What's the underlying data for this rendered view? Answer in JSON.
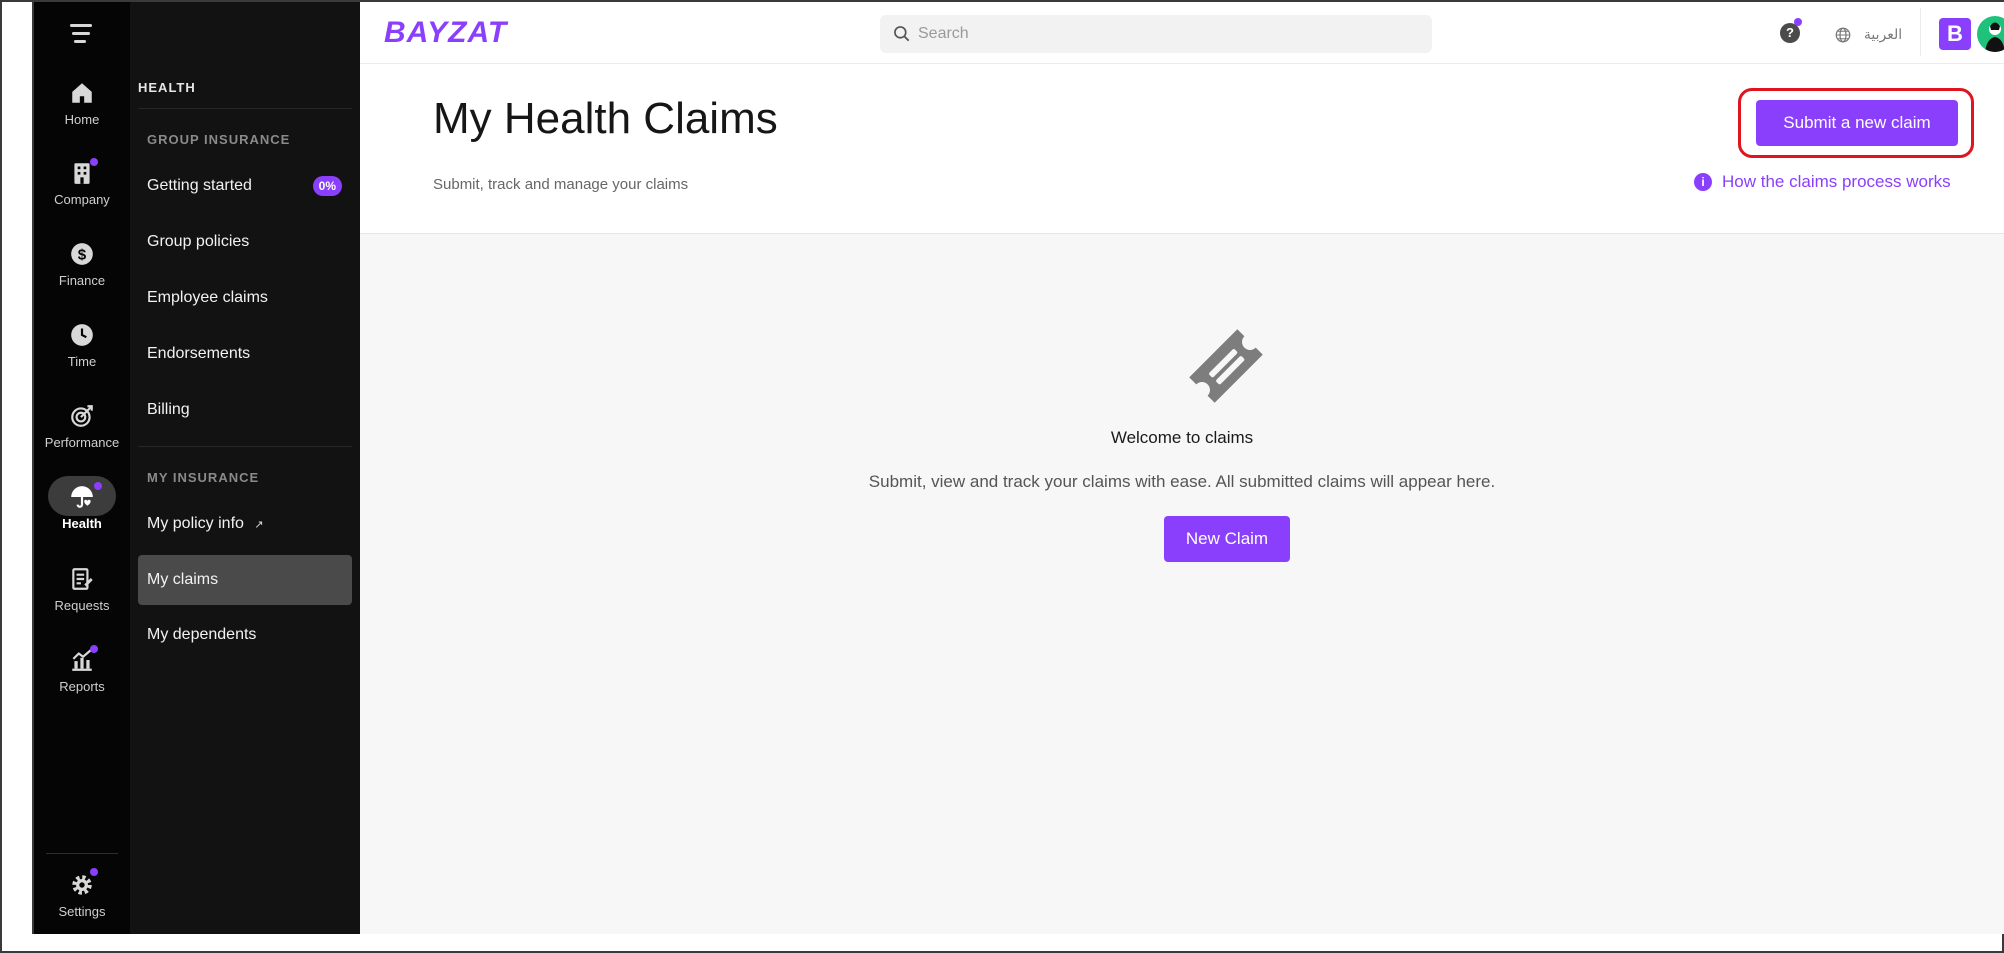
{
  "brand": {
    "logo_text": "BAYZAT",
    "accent_color": "#8a3ffc",
    "account_logo_letter": "B"
  },
  "rail": {
    "items": [
      {
        "label": "Home",
        "icon": "home-icon"
      },
      {
        "label": "Company",
        "icon": "building-icon"
      },
      {
        "label": "Finance",
        "icon": "dollar-icon"
      },
      {
        "label": "Time",
        "icon": "clock-icon"
      },
      {
        "label": "Performance",
        "icon": "target-icon"
      },
      {
        "label": "Health",
        "icon": "health-umbrella-icon",
        "active": true
      },
      {
        "label": "Requests",
        "icon": "requests-icon"
      },
      {
        "label": "Reports",
        "icon": "reports-chart-icon"
      }
    ],
    "settings_label": "Settings"
  },
  "subnav": {
    "section_title": "HEALTH",
    "group_header": "GROUP INSURANCE",
    "group_items": [
      {
        "label": "Getting started",
        "badge": "0%"
      },
      {
        "label": "Group policies"
      },
      {
        "label": "Employee claims"
      },
      {
        "label": "Endorsements"
      },
      {
        "label": "Billing"
      }
    ],
    "my_header": "MY INSURANCE",
    "my_items": [
      {
        "label": "My policy info",
        "external": true
      },
      {
        "label": "My claims",
        "active": true
      },
      {
        "label": "My dependents"
      }
    ]
  },
  "topbar": {
    "search_placeholder": "Search",
    "help_label": "?",
    "language_label": "العربية"
  },
  "page": {
    "title": "My Health Claims",
    "subtitle": "Submit, track and manage your claims",
    "submit_button": "Submit a new claim",
    "how_link": "How the claims process works",
    "info_glyph": "i"
  },
  "empty_state": {
    "heading": "Welcome to claims",
    "description": "Submit, view and track your claims with ease. All submitted claims will appear here.",
    "button": "New Claim"
  }
}
